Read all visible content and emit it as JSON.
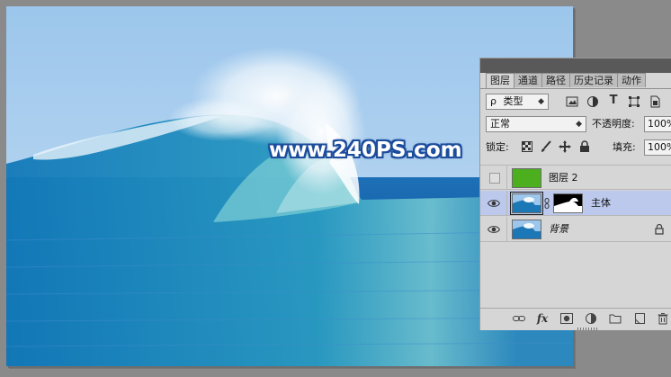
{
  "watermark": "www.240PS.com",
  "panel": {
    "tabs": [
      {
        "label": "图层",
        "active": true
      },
      {
        "label": "通道",
        "active": false
      },
      {
        "label": "路径",
        "active": false
      },
      {
        "label": "历史记录",
        "active": false
      },
      {
        "label": "动作",
        "active": false
      }
    ],
    "filter": {
      "prefix": "ρ",
      "label": "类型"
    },
    "blend_mode": "正常",
    "opacity_label": "不透明度:",
    "opacity_value": "100%",
    "lock_label": "锁定:",
    "fill_label": "填充:",
    "fill_value": "100%",
    "layers": [
      {
        "name": "图层 2",
        "visible": false,
        "thumb": "green",
        "selected": false
      },
      {
        "name": "主体",
        "visible": true,
        "thumb": "wave-with-mask",
        "selected": true
      },
      {
        "name": "背景",
        "visible": true,
        "thumb": "wave",
        "selected": false,
        "locked": true
      }
    ]
  },
  "colors": {
    "panel_bg": "#d6d6d6",
    "selected_row": "#bcc9ec",
    "layer2_fill": "#4caf1e",
    "watermark_outline": "#1c4d9c"
  }
}
